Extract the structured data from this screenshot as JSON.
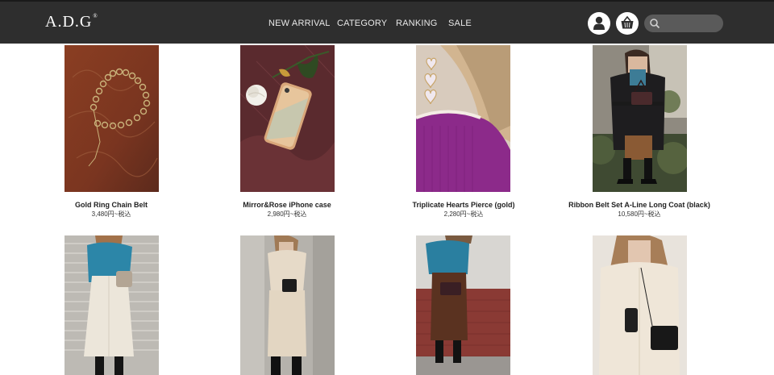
{
  "header": {
    "logo": "A.D.G",
    "logo_mark": "®",
    "nav": [
      "NEW ARRIVAL",
      "CATEGORY",
      "RANKING",
      "SALE"
    ],
    "search": {
      "placeholder": "",
      "value": ""
    },
    "icons": [
      "user-icon",
      "cart-basket-icon",
      "search-icon"
    ]
  },
  "products": [
    {
      "name": "Gold Ring Chain Belt",
      "price": "3,480円~税込"
    },
    {
      "name": "Mirror&Rose iPhone case",
      "price": "2,980円~税込"
    },
    {
      "name": "Triplicate Hearts Pierce (gold)",
      "price": "2,280円~税込"
    },
    {
      "name": "Ribbon Belt Set A-Line Long Coat (black)",
      "price": "10,580円~税込"
    }
  ],
  "colors": {
    "header_bg": "#2e2e2e",
    "nav_text": "#e8e8e8",
    "search_bg": "#5a5a5a"
  }
}
